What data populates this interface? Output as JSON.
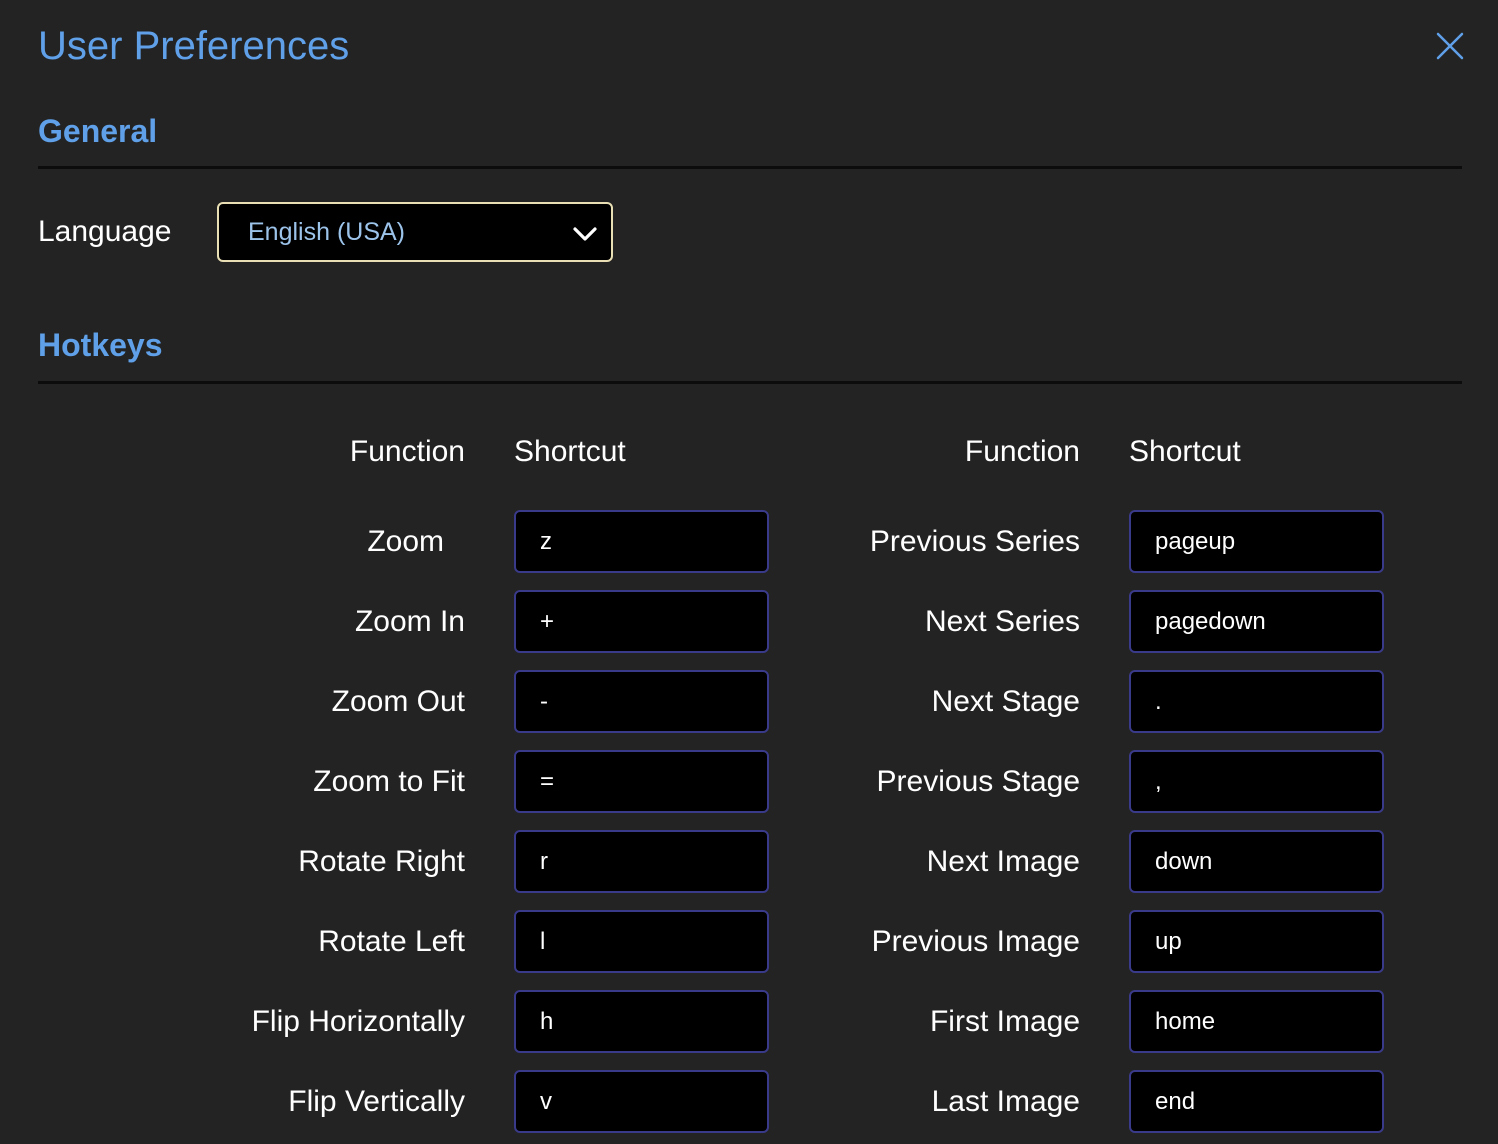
{
  "dialog": {
    "title": "User Preferences",
    "close_icon": "close-icon",
    "accent_color": "#5fa0e8"
  },
  "general": {
    "heading": "General",
    "language_label": "Language",
    "language_value": "English (USA)",
    "dropdown_icon": "chevron-down-icon"
  },
  "hotkeys": {
    "heading": "Hotkeys",
    "function_header": "Function",
    "shortcut_header": "Shortcut",
    "left": [
      {
        "function": "Zoom",
        "shortcut": "z"
      },
      {
        "function": "Zoom In",
        "shortcut": "+"
      },
      {
        "function": "Zoom Out",
        "shortcut": "-"
      },
      {
        "function": "Zoom to Fit",
        "shortcut": "="
      },
      {
        "function": "Rotate Right",
        "shortcut": "r"
      },
      {
        "function": "Rotate Left",
        "shortcut": "l"
      },
      {
        "function": "Flip Horizontally",
        "shortcut": "h"
      },
      {
        "function": "Flip Vertically",
        "shortcut": "v"
      }
    ],
    "right": [
      {
        "function": "Previous Series",
        "shortcut": "pageup"
      },
      {
        "function": "Next Series",
        "shortcut": "pagedown"
      },
      {
        "function": "Next Stage",
        "shortcut": "."
      },
      {
        "function": "Previous Stage",
        "shortcut": ","
      },
      {
        "function": "Next Image",
        "shortcut": "down"
      },
      {
        "function": "Previous Image",
        "shortcut": "up"
      },
      {
        "function": "First Image",
        "shortcut": "home"
      },
      {
        "function": "Last Image",
        "shortcut": "end"
      }
    ]
  }
}
